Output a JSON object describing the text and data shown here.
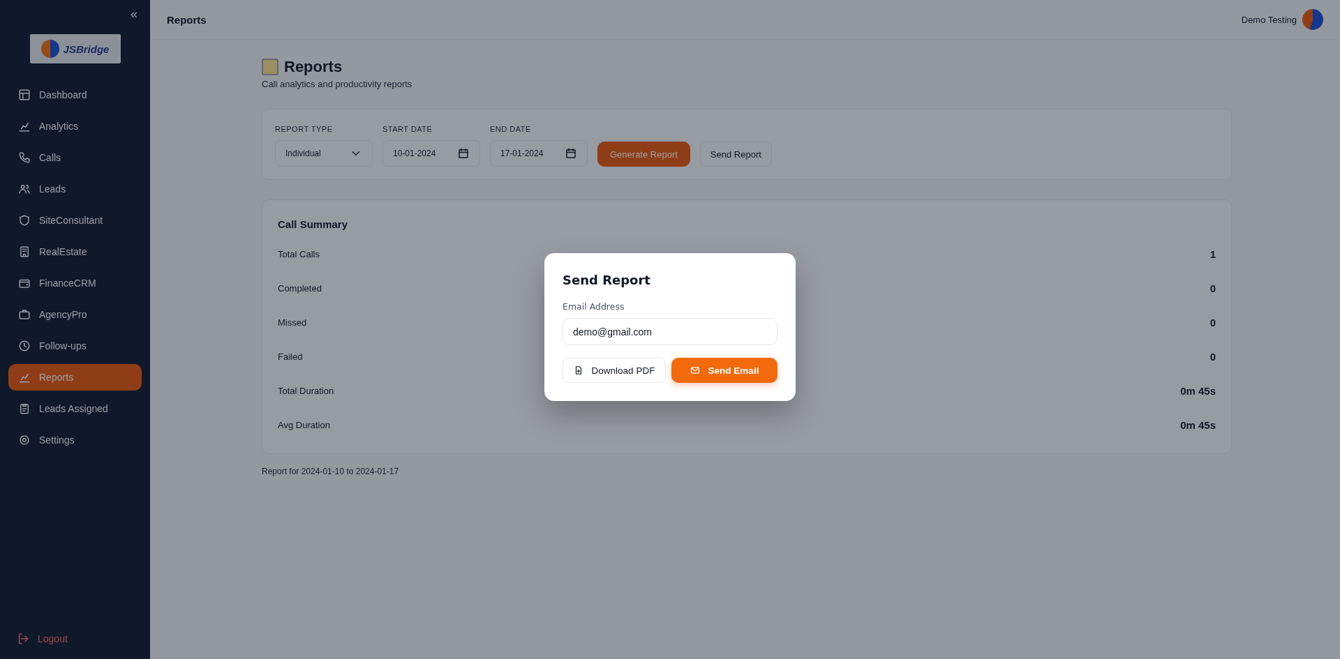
{
  "sidebar": {
    "collapse": "«",
    "logo_alt": "JSBridge",
    "items": [
      {
        "label": "Dashboard",
        "selected": false
      },
      {
        "label": "Analytics",
        "selected": false
      },
      {
        "label": "Calls",
        "selected": false
      },
      {
        "label": "Leads",
        "selected": false
      },
      {
        "label": "SiteConsultant",
        "selected": false
      },
      {
        "label": "RealEstate",
        "selected": false
      },
      {
        "label": "FinanceCRM",
        "selected": false
      },
      {
        "label": "AgencyPro",
        "selected": false
      },
      {
        "label": "Follow-ups",
        "selected": false
      },
      {
        "label": "Reports",
        "selected": true
      },
      {
        "label": "Leads Assigned",
        "selected": false
      },
      {
        "label": "Settings",
        "selected": false
      }
    ],
    "logout": "Logout"
  },
  "header": {
    "title": "Reports",
    "user": "Demo Testing"
  },
  "page": {
    "title": "Reports",
    "subtitle": "Call analytics and productivity reports"
  },
  "filters": {
    "report_type": {
      "label": "REPORT TYPE",
      "value": "Individual"
    },
    "start_date": {
      "label": "START DATE",
      "value": "10-01-2024"
    },
    "end_date": {
      "label": "END DATE",
      "value": "17-01-2024"
    },
    "generate": "Generate Report",
    "send": "Send Report"
  },
  "summary": {
    "title": "Call Summary",
    "rows": [
      {
        "label": "Total Calls",
        "value": "1"
      },
      {
        "label": "Completed",
        "value": "0"
      },
      {
        "label": "Missed",
        "value": "0"
      },
      {
        "label": "Failed",
        "value": "0"
      },
      {
        "label": "Total Duration",
        "value": "0m 45s"
      },
      {
        "label": "Avg Duration",
        "value": "0m 45s"
      }
    ]
  },
  "footnote": "Report for 2024-01-10 to 2024-01-17",
  "modal": {
    "title": "Send Report",
    "email_label": "Email Address",
    "email_value": "demo@gmail.com",
    "download": "Download PDF",
    "send": "Send Email"
  }
}
